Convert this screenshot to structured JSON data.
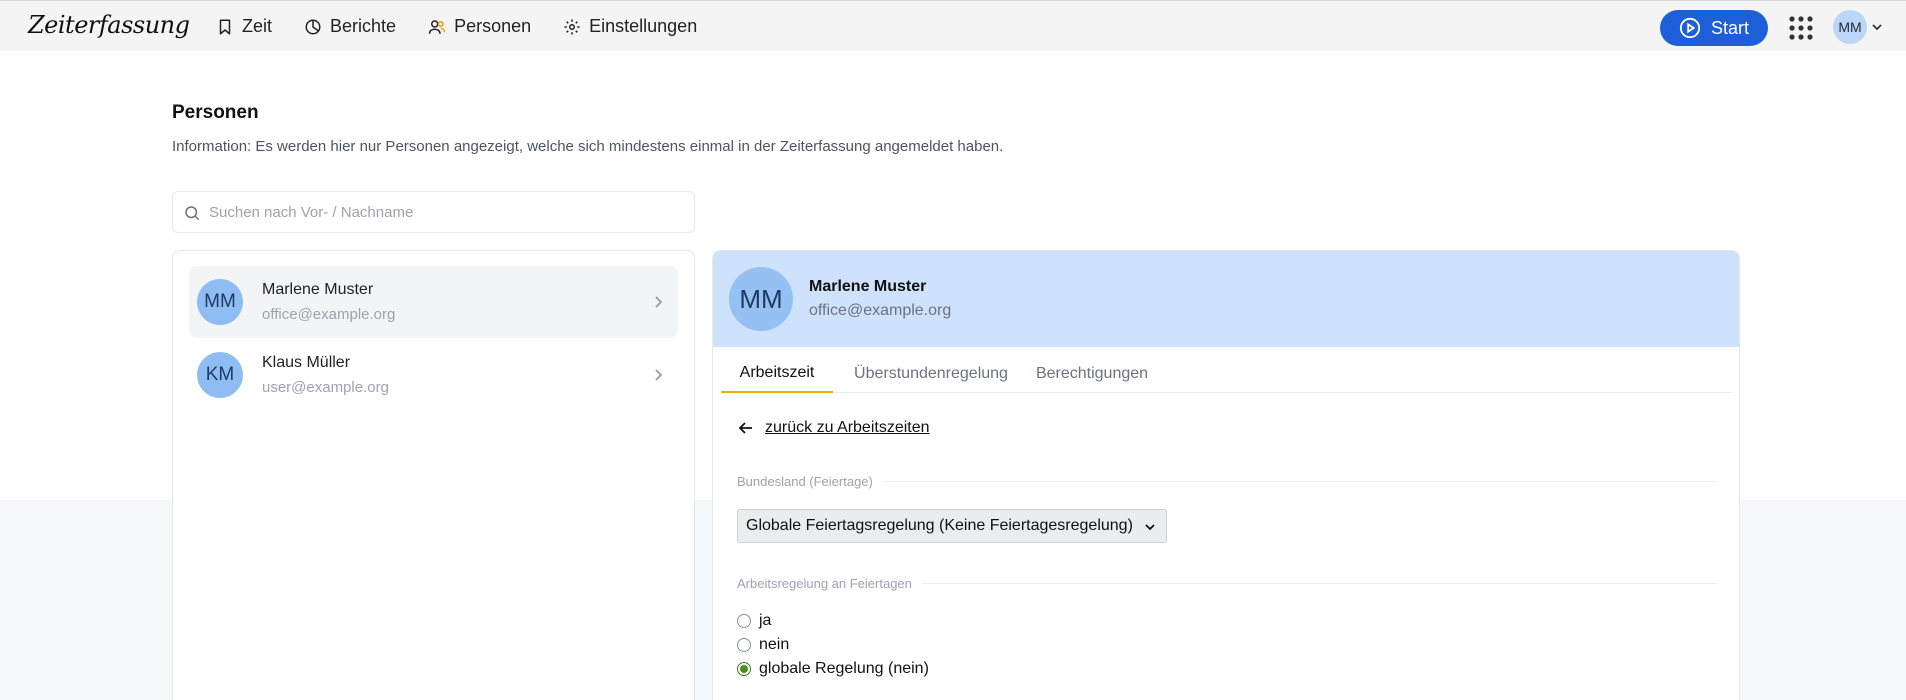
{
  "header": {
    "logo": "Zeiterfassung",
    "nav": [
      {
        "label": "Zeit",
        "icon": "bookmark-icon"
      },
      {
        "label": "Berichte",
        "icon": "pie-chart-icon"
      },
      {
        "label": "Personen",
        "icon": "users-icon"
      },
      {
        "label": "Einstellungen",
        "icon": "gear-icon"
      }
    ],
    "start_label": "Start",
    "user_initials": "MM",
    "accent_color": "#1d5fd8"
  },
  "page": {
    "title": "Personen",
    "info": "Information: Es werden hier nur Personen angezeigt, welche sich mindestens einmal in der Zeiterfassung angemeldet haben."
  },
  "search": {
    "placeholder": "Suchen nach Vor- / Nachname",
    "value": ""
  },
  "persons": [
    {
      "initials": "MM",
      "name": "Marlene Muster",
      "email": "office@example.org",
      "active": true
    },
    {
      "initials": "KM",
      "name": "Klaus Müller",
      "email": "user@example.org",
      "active": false
    }
  ],
  "detail": {
    "initials": "MM",
    "name": "Marlene Muster",
    "email": "office@example.org",
    "tabs": [
      {
        "label": "Arbeitszeit",
        "active": true
      },
      {
        "label": "Überstundenregelung",
        "active": false
      },
      {
        "label": "Berechtigungen",
        "active": false
      }
    ],
    "back_label": "zurück zu Arbeitszeiten",
    "holiday_section_label": "Bundesland (Feiertage)",
    "holiday_select_value": "Globale Feiertagsregelung (Keine Feiertagesregelung)",
    "work_rule_section_label": "Arbeitsregelung an Feiertagen",
    "work_rule_options": [
      {
        "label": "ja",
        "checked": false
      },
      {
        "label": "nein",
        "checked": false
      },
      {
        "label": "globale Regelung (nein)",
        "checked": true
      }
    ]
  }
}
